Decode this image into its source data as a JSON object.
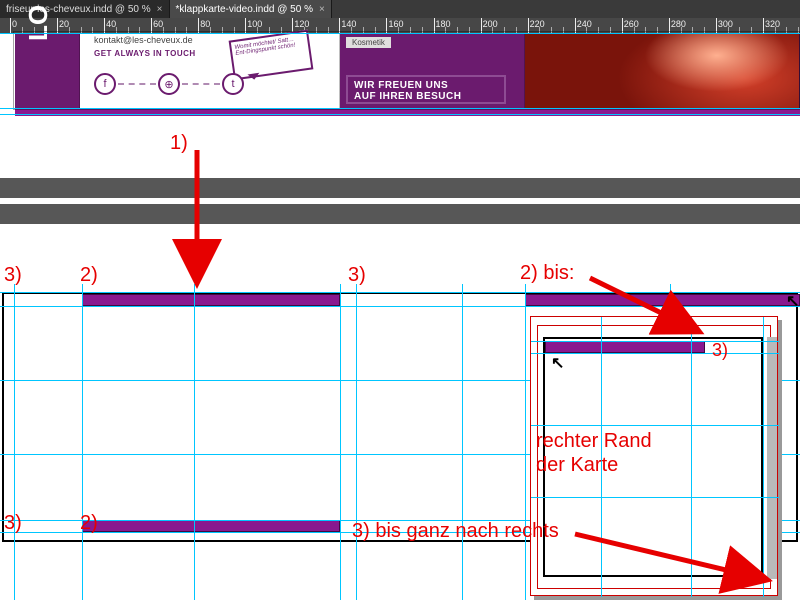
{
  "tabs": [
    {
      "label": "friseur-les-cheveux.indd @ 50 %",
      "active": false
    },
    {
      "label": "*klappkarte-video.indd @ 50 %",
      "active": true
    }
  ],
  "ruler_ticks": [
    0,
    20,
    40,
    60,
    80,
    100,
    120,
    140,
    160,
    180,
    200,
    220,
    240,
    260,
    280,
    300,
    320
  ],
  "brochure": {
    "logo": "LO",
    "email": "kontakt@les-cheveux.de",
    "slogan": "GET ALWAYS IN TOUCH",
    "speech": "Womit möchtet/ Satt… Ent-Dingspunkt schön!",
    "tag": "Kosmetik",
    "freuen_line1": "WIR FREUEN UNS",
    "freuen_line2": "AUF IHREN BESUCH",
    "icons": [
      "f",
      "⊕",
      "t"
    ]
  },
  "annotations": {
    "a1": "1)",
    "a2l": "2)",
    "a3l": "3)",
    "a3m": "3)",
    "a2bis": "2) bis:",
    "a3r": "3)",
    "rtext_l1": "rechter Rand",
    "rtext_l2": "der Karte",
    "a3ganz": "3) bis ganz nach rechts",
    "a2bl": "2)",
    "a3bl": "3)"
  },
  "colors": {
    "brand_purple": "#6b1b6e",
    "accent_magenta": "#89198f",
    "annotation_red": "#e60000",
    "guide_cyan": "#00c6ff"
  }
}
